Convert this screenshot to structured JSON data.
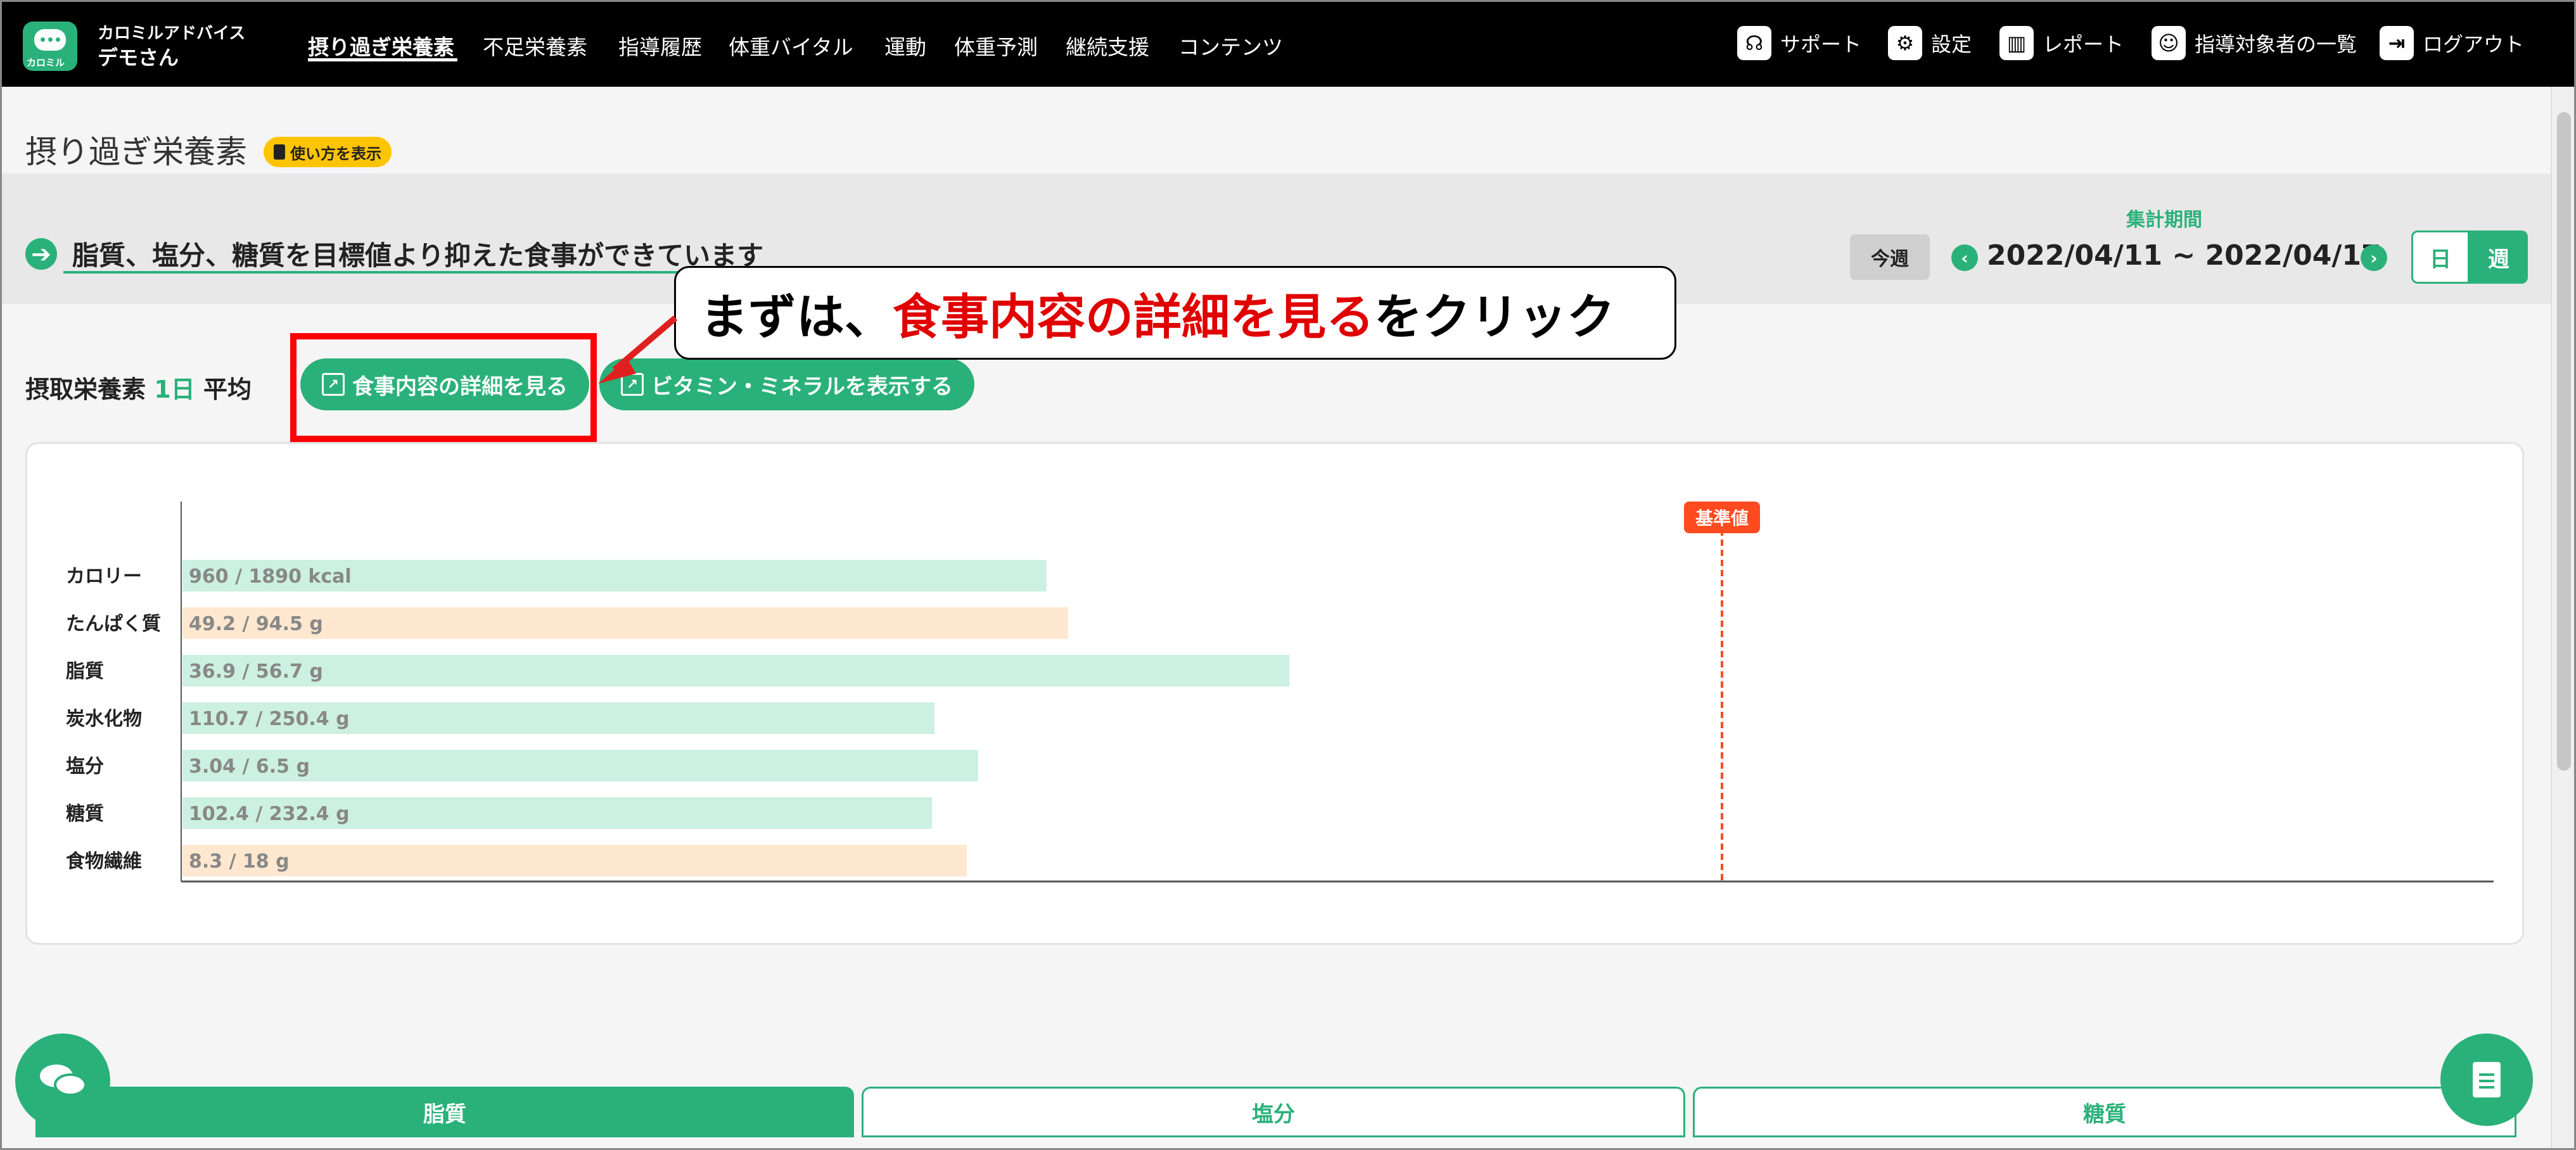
{
  "header": {
    "logo_text": "カロミル",
    "app_name": "カロミルアドバイス",
    "user": "デモさん",
    "nav": [
      "摂り過ぎ栄養素",
      "不足栄養素",
      "指導履歴",
      "体重バイタル",
      "運動",
      "体重予測",
      "継続支援",
      "コンテンツ"
    ],
    "util": {
      "support": "サポート",
      "settings": "設定",
      "report": "レポート",
      "clients": "指導対象者の一覧",
      "logout": "ログアウト"
    }
  },
  "page": {
    "title": "摂り過ぎ栄養素",
    "howto": "使い方を表示"
  },
  "summary": {
    "icon": "arrow-right-icon",
    "text": "脂質、塩分、糖質を目標値より抑えた食事ができています"
  },
  "period": {
    "label": "集計期間",
    "this_week": "今週",
    "range": "2022/04/11 ~ 2022/04/17",
    "day": "日",
    "week": "週"
  },
  "intake": {
    "label": "摂取栄養素",
    "day": "1日",
    "avg": "平均",
    "btn_meal_detail": "食事内容の詳細を見る",
    "btn_vitamin": "ビタミン・ミネラルを表示する"
  },
  "callout": {
    "pre": "まずは、",
    "highlight": "食事内容の詳細を見る",
    "post": "をクリック"
  },
  "chart_data": {
    "type": "bar",
    "reference_label": "基準値",
    "categories": [
      "カロリー",
      "たんぱく質",
      "脂質",
      "炭水化物",
      "塩分",
      "糖質",
      "食物繊維"
    ],
    "values": [
      960,
      49.2,
      36.9,
      110.7,
      3.04,
      102.4,
      8.3
    ],
    "targets": [
      1890,
      94.5,
      56.7,
      250.4,
      6.5,
      232.4,
      18
    ],
    "units": [
      "kcal",
      "g",
      "g",
      "g",
      "g",
      "g",
      "g"
    ],
    "labels": [
      "960 / 1890 kcal",
      "49.2 / 94.5 g",
      "36.9 / 56.7 g",
      "110.7 / 250.4 g",
      "3.04 / 6.5 g",
      "102.4 / 232.4 g",
      "8.3 / 18 g"
    ],
    "status": [
      "over",
      "under",
      "over",
      "over",
      "over",
      "over",
      "under"
    ],
    "colors": {
      "over": "#ccf0e2",
      "under": "#ffe8cf",
      "reference": "#ff4b1f"
    }
  },
  "bottom_tabs": [
    "脂質",
    "塩分",
    "糖質"
  ],
  "colors": {
    "accent": "#2ab17a",
    "highlight": "#ff0000",
    "badge": "#ffc400"
  }
}
